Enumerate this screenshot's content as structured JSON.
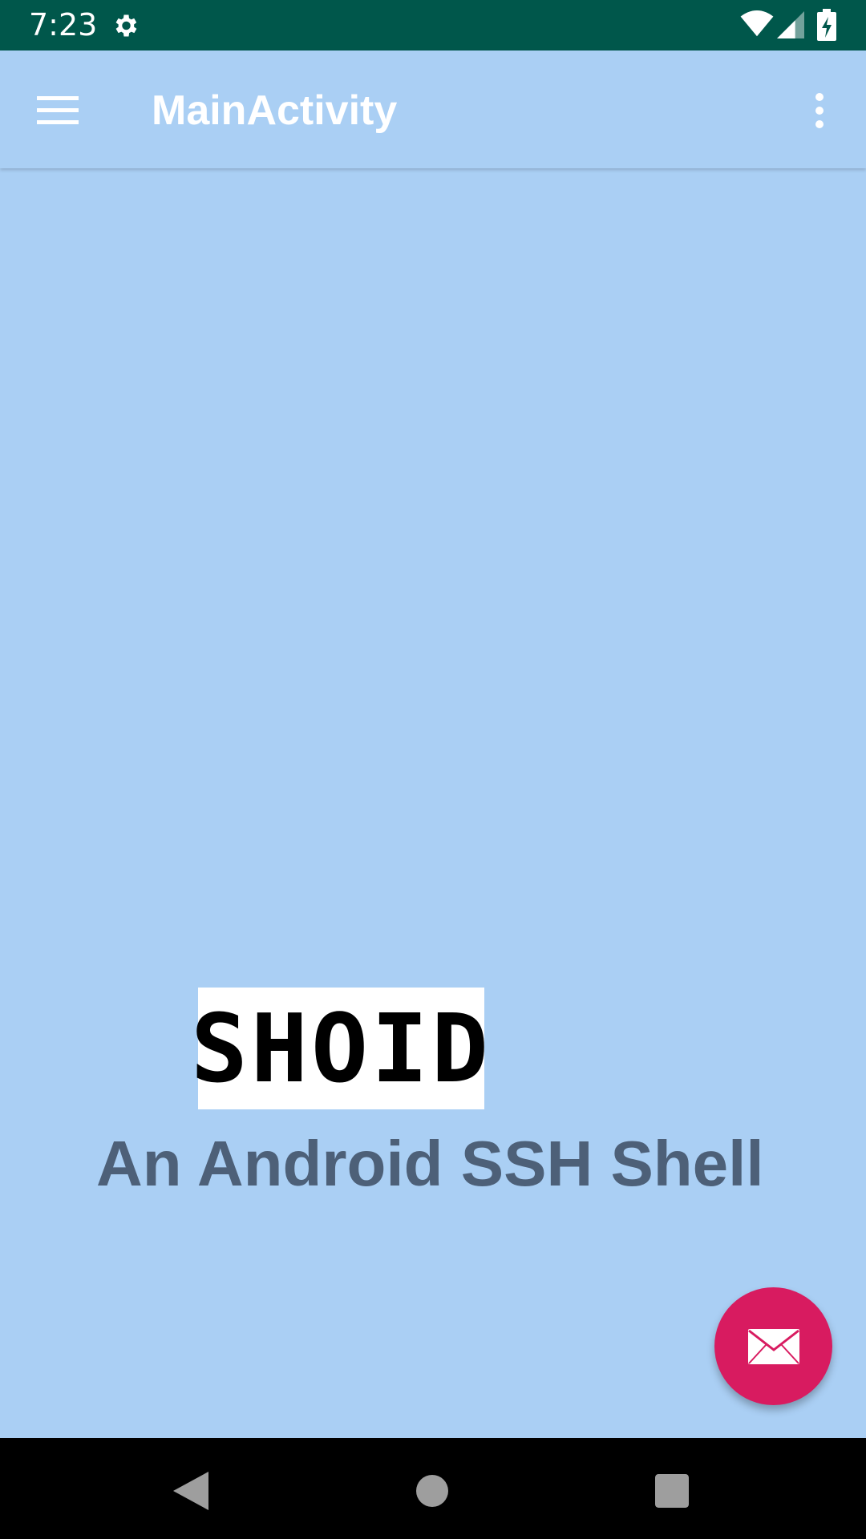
{
  "status_bar": {
    "time": "7:23",
    "icons": [
      "gear-icon",
      "wifi-icon",
      "cell-signal-icon",
      "battery-charging-icon"
    ],
    "background": "#00574b"
  },
  "app_bar": {
    "title": "MainActivity",
    "menu_icon": "hamburger-menu-icon",
    "overflow_icon": "more-vert-icon"
  },
  "content": {
    "logo_text": "SHOID",
    "tagline": "An Android SSH Shell",
    "background": "#aacff4"
  },
  "fab": {
    "icon": "email-icon",
    "color": "#d81b60"
  },
  "nav_bar": {
    "buttons": [
      "back-icon",
      "home-icon",
      "recents-icon"
    ]
  }
}
